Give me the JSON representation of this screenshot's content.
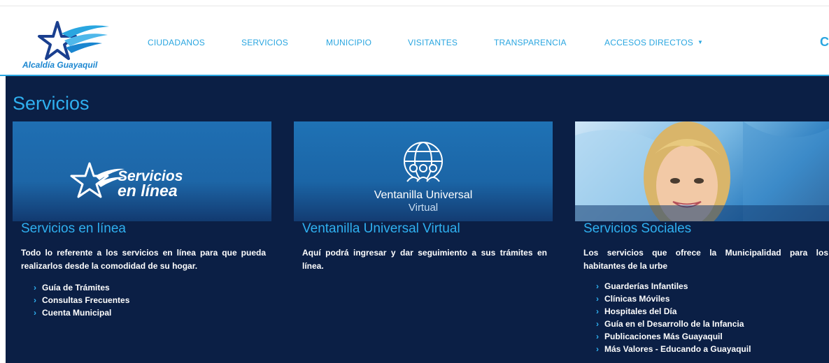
{
  "header": {
    "logo_text": "Alcaldía Guayaquil",
    "nav": [
      "CIUDADANOS",
      "SERVICIOS",
      "MUNICIPIO",
      "VISITANTES",
      "TRANSPARENCIA",
      "ACCESOS DIRECTOS"
    ],
    "search_fragment": "C",
    "brand_color": "#2aa6e0"
  },
  "main": {
    "title": "Servicios",
    "background": "#0b1f45",
    "cards": [
      {
        "title": "Servicios en línea",
        "image_text": [
          "Servicios",
          "en línea"
        ],
        "description": "Todo lo referente a los servicios en línea para que pueda realizarlos desde la comodidad de su hogar.",
        "links": [
          "Guía de Trámites",
          "Consultas Frecuentes",
          "Cuenta Municipal"
        ]
      },
      {
        "title": "Ventanilla Universal Virtual",
        "image_text": [
          "Ventanilla Universal",
          "Virtual"
        ],
        "icon": "globe-people-icon",
        "description": "Aquí podrá ingresar y dar seguimiento a sus trámites en línea.",
        "links": []
      },
      {
        "title": "Servicios Sociales",
        "description": "Los servicios que ofrece la Municipalidad para los habitantes de la urbe",
        "links": [
          "Guarderías Infantiles",
          "Clínicas Móviles",
          "Hospitales del Día",
          "Guía en el Desarrollo de la Infancia",
          "Publicaciones Más Guayaquil",
          "Más Valores - Educando a Guayaquil"
        ]
      }
    ]
  }
}
